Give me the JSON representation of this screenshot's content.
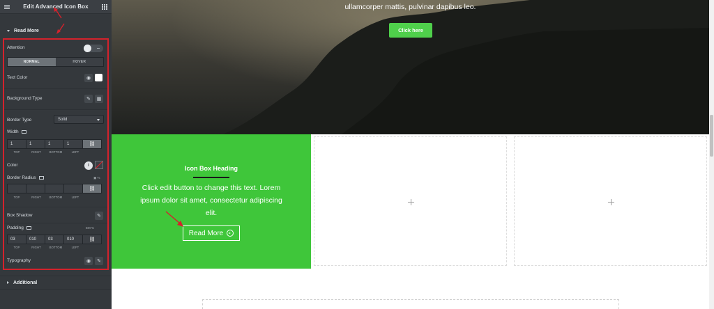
{
  "panel": {
    "title": "Edit Advanced Icon Box",
    "section_read_more": "Read More",
    "section_additional": "Additional",
    "attention_label": "Attention",
    "tabs": [
      "NORMAL",
      "HOVER"
    ],
    "text_color_label": "Text Color",
    "background_type_label": "Background Type",
    "border_type_label": "Border Type",
    "border_type_value": "Solid",
    "width_label": "Width",
    "width_values": [
      "1",
      "1",
      "1",
      "1"
    ],
    "dim_labels": [
      "TOP",
      "RIGHT",
      "BOTTOM",
      "LEFT"
    ],
    "color_label": "Color",
    "border_radius_label": "Border Radius",
    "border_radius_values": [
      "",
      "",
      "",
      ""
    ],
    "box_shadow_label": "Box Shadow",
    "padding_label": "Padding",
    "padding_values": [
      "03",
      "010",
      "03",
      "010"
    ],
    "padding_units": "EM  %",
    "typography_label": "Typography"
  },
  "hero": {
    "text": "ullamcorper mattis, pulvinar dapibus leo.",
    "button_label": "Click here"
  },
  "iconbox": {
    "heading": "Icon Box Heading",
    "text": "Click edit button to change this text. Lorem ipsum dolor sit amet, consectetur adipiscing elit.",
    "button_label": "Read More"
  },
  "colors": {
    "panel_bg": "#34383c",
    "accent_green": "#3fc63a",
    "button_green": "#4fd04b",
    "highlight_red": "#d4222c",
    "text_color_swatch": "#ffffff"
  },
  "icons": [
    "hamburger-icon",
    "grid-icon",
    "globe-icon",
    "brush-icon",
    "gradient-icon",
    "info-icon",
    "pencil-icon",
    "link-icon",
    "monitor-icon",
    "arrow-circle-right-icon",
    "plus-icon",
    "chevron-left-icon"
  ]
}
